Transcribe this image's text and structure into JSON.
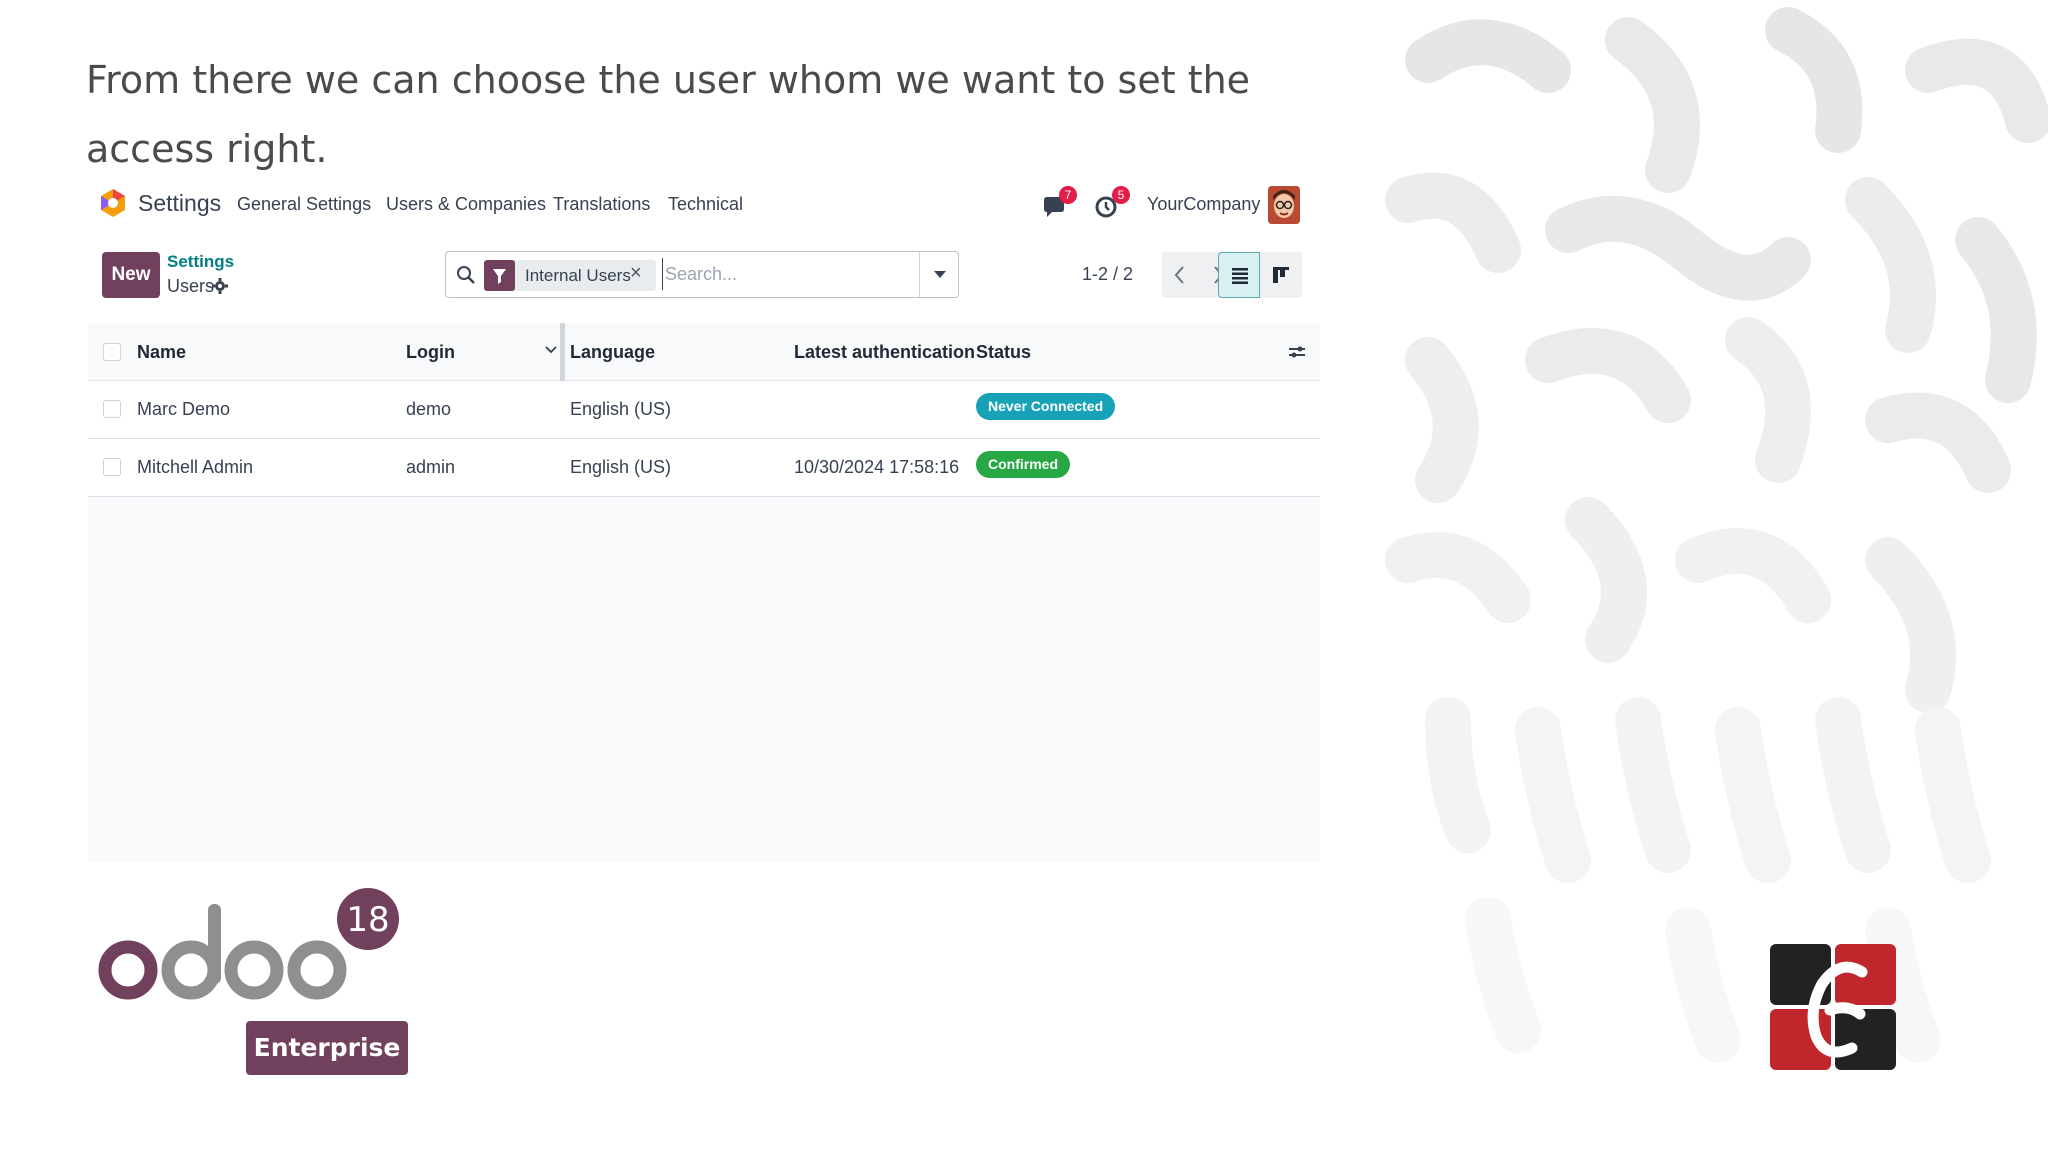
{
  "caption": "From there we can choose the user whom we want to set the access right.",
  "navbar": {
    "app_name": "Settings",
    "menu": [
      "General Settings",
      "Users & Companies",
      "Translations",
      "Technical"
    ],
    "messages_count": "7",
    "activities_count": "5",
    "company": "YourCompany"
  },
  "control_panel": {
    "new_label": "New",
    "breadcrumb_parent": "Settings",
    "breadcrumb_current": "Users",
    "facet_label": "Internal Users",
    "facet_remove": "×",
    "search_placeholder": "Search...",
    "pager": "1-2 / 2"
  },
  "table": {
    "headers": [
      "Name",
      "Login",
      "Language",
      "Latest authentication",
      "Status"
    ],
    "rows": [
      {
        "name": "Marc Demo",
        "login": "demo",
        "language": "English (US)",
        "latest_auth": "",
        "status": "Never Connected"
      },
      {
        "name": "Mitchell Admin",
        "login": "admin",
        "language": "English (US)",
        "latest_auth": "10/30/2024 17:58:16",
        "status": "Confirmed"
      }
    ]
  },
  "colors": {
    "brand": "#71405d",
    "never_connected": "#17a2b8",
    "confirmed": "#28a745",
    "breadcrumb": "#017e84"
  },
  "branding": {
    "version": "18",
    "edition": "Enterprise",
    "wordmark": "odoo"
  }
}
